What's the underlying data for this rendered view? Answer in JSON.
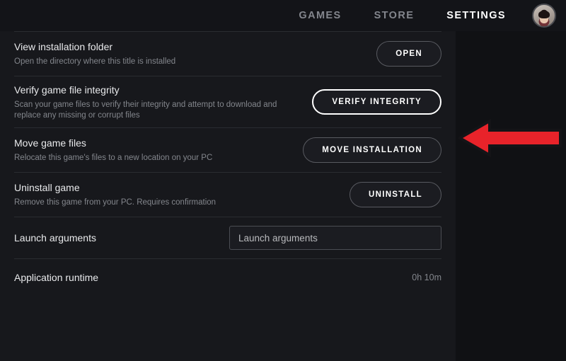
{
  "nav": {
    "items": [
      {
        "label": "GAMES",
        "active": false
      },
      {
        "label": "STORE",
        "active": false
      },
      {
        "label": "SETTINGS",
        "active": true
      }
    ],
    "avatar_alt": "user-avatar"
  },
  "rows": [
    {
      "title": "View installation folder",
      "subtitle": "Open the directory where this title is installed",
      "button": "OPEN",
      "focused": false
    },
    {
      "title": "Verify game file integrity",
      "subtitle": "Scan your game files to verify their integrity and attempt to download and replace any missing or corrupt files",
      "button": "VERIFY INTEGRITY",
      "focused": true
    },
    {
      "title": "Move game files",
      "subtitle": "Relocate this game's files to a new location on your PC",
      "button": "MOVE INSTALLATION",
      "focused": false
    },
    {
      "title": "Uninstall game",
      "subtitle": "Remove this game from your PC. Requires confirmation",
      "button": "UNINSTALL",
      "focused": false
    }
  ],
  "launch_arguments": {
    "label": "Launch arguments",
    "placeholder": "Launch arguments",
    "value": ""
  },
  "application_runtime": {
    "label": "Application runtime",
    "value": "0h 10m"
  },
  "annotation": {
    "type": "arrow-left",
    "color": "#e8232a",
    "outline_color": "#141417",
    "points_at": "VERIFY INTEGRITY"
  }
}
